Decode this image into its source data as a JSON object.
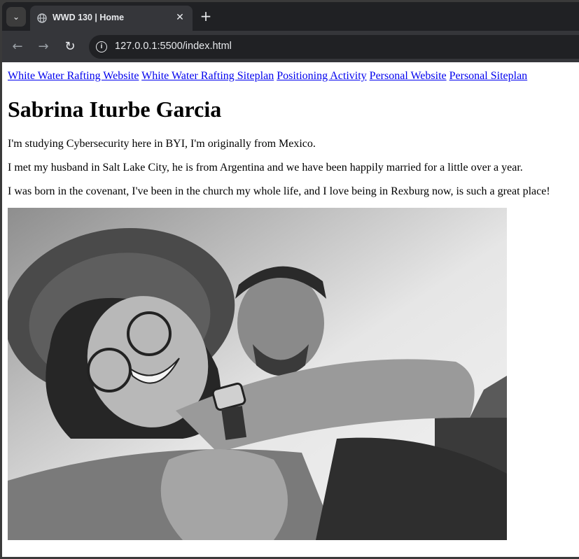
{
  "browser": {
    "tab": {
      "title": "WWD 130 | Home",
      "favicon": "globe-icon",
      "close_icon": "close-icon"
    },
    "new_tab_icon": "plus-icon",
    "tab_search_icon": "chevron-down-icon",
    "toolbar": {
      "back_icon": "arrow-left-icon",
      "forward_icon": "arrow-right-icon",
      "reload_icon": "reload-icon",
      "site_info_icon": "info-icon"
    },
    "url": "127.0.0.1:5500/index.html"
  },
  "page": {
    "nav_links": [
      "White Water Rafting Website",
      "White Water Rafting Siteplan",
      "Positioning Activity",
      "Personal Website",
      "Personal Siteplan"
    ],
    "heading": "Sabrina Iturbe Garcia",
    "paragraphs": [
      "I'm studying Cybersecurity here in BYI, I'm originally from Mexico.",
      "I met my husband in Salt Lake City, he is from Argentina and we have been happily married for a little over a year.",
      "I was born in the covenant, I've been in the church my whole life, and I love being in Rexburg now, is such a great place!"
    ]
  },
  "colors": {
    "chrome_dark": "#202124",
    "chrome_toolbar": "#35363a",
    "link": "#0000ee"
  }
}
